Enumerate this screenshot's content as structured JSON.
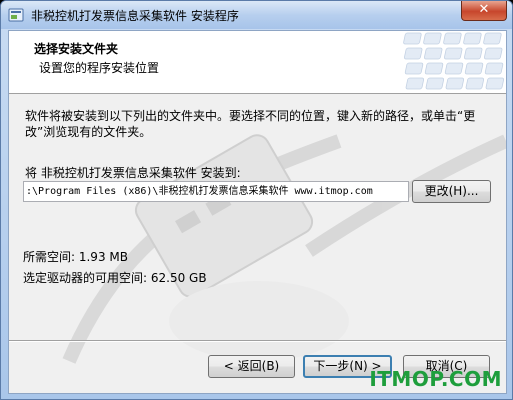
{
  "window": {
    "title": "非税控机打发票信息采集软件 安装程序",
    "close_label": "✕"
  },
  "header": {
    "title": "选择安装文件夹",
    "subtitle": "设置您的程序安装位置"
  },
  "body": {
    "description": "软件将被安装到以下列出的文件夹中。要选择不同的位置，键入新的路径，或单击“更改”浏览现有的文件夹。",
    "dest_label": "将 非税控机打发票信息采集软件 安装到:",
    "path_value": ":\\Program Files (x86)\\非税控机打发票信息采集软件 www.itmop.com",
    "change_button": "更改(H)...",
    "required_space": "所需空间: 1.93 MB",
    "free_space": "选定驱动器的可用空间: 62.50 GB"
  },
  "footer": {
    "back_button": "< 返回(B)",
    "next_button": "下一步(N) >",
    "cancel_button": "取消(C)"
  },
  "watermark_text": "ITMOP.COM",
  "colors": {
    "title_bar": "#b7cfee",
    "close_button": "#c7462c",
    "default_button_border": "#3c7fb1",
    "watermark_green": "#1e9e3c"
  }
}
